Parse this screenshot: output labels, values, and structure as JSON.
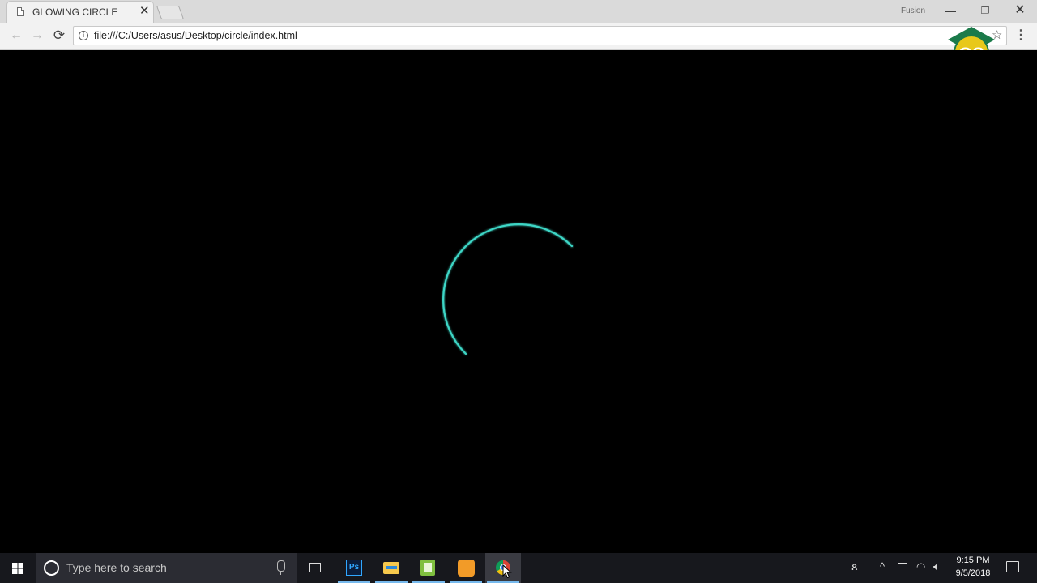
{
  "browser": {
    "tab": {
      "title": "GLOWING CIRCLE",
      "close_glyph": "✕",
      "icon": "document-icon"
    },
    "profile_label": "Fusion",
    "window_controls": {
      "minimize": "—",
      "restore": "❐",
      "close": "✕"
    },
    "toolbar": {
      "back_glyph": "←",
      "forward_glyph": "→",
      "reload_glyph": "⟳",
      "info_glyph": "i",
      "url": "file:///C:/Users/asus/Desktop/circle/index.html",
      "star_glyph": "☆",
      "menu_glyph": "⋮"
    },
    "logo_text": "GS"
  },
  "page": {
    "background": "#000000",
    "circle_color": "#3ed6c6"
  },
  "taskbar": {
    "search_placeholder": "Type here to search",
    "apps": [
      "task-view",
      "photoshop",
      "file-explorer",
      "notepad",
      "vlc",
      "chrome"
    ],
    "photoshop_label": "Ps",
    "tray": {
      "people_glyph": "ጰ",
      "chevron_glyph": "^",
      "wifi_glyph": "◠",
      "volume_glyph": "🔈︎"
    },
    "clock": {
      "time": "9:15 PM",
      "date": "9/5/2018"
    }
  }
}
